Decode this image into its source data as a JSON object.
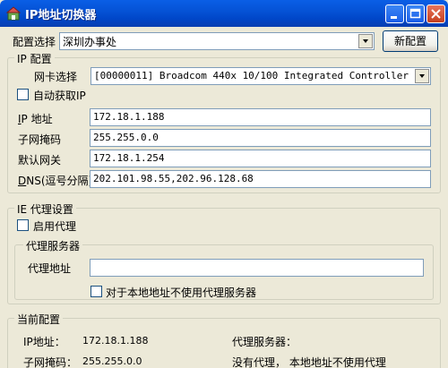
{
  "window": {
    "title": "IP地址切换器"
  },
  "config": {
    "select_label": "配置选择",
    "select_value": "深圳办事处",
    "new_button": "新配置"
  },
  "ip_group": {
    "title": "IP 配置",
    "nic_label": "网卡选择",
    "nic_value": "[00000011] Broadcom 440x 10/100 Integrated Controller",
    "auto_label": "自动获取IP",
    "ip_label_prefix": "I",
    "ip_label_rest": "P 地址",
    "ip_value": "172.18.1.188",
    "mask_label": "子网掩码",
    "mask_value": "255.255.0.0",
    "gw_label": "默认网关",
    "gw_value": "172.18.1.254",
    "dns_label_prefix": "D",
    "dns_label_rest": "NS(逗号分隔)",
    "dns_value": "202.101.98.55,202.96.128.68"
  },
  "proxy_group": {
    "title": "IE 代理设置",
    "enable_label": "启用代理",
    "server_group_title": "代理服务器",
    "address_label": "代理地址",
    "address_value": "",
    "bypass_label": "对于本地地址不使用代理服务器"
  },
  "current": {
    "title": "当前配置",
    "ip_label": "IP地址：",
    "ip_value": "172.18.1.188",
    "mask_label": "子网掩码：",
    "mask_value": "255.255.0.0",
    "proxy_label": "代理服务器：",
    "proxy_value": "没有代理， 本地地址不使用代理"
  }
}
